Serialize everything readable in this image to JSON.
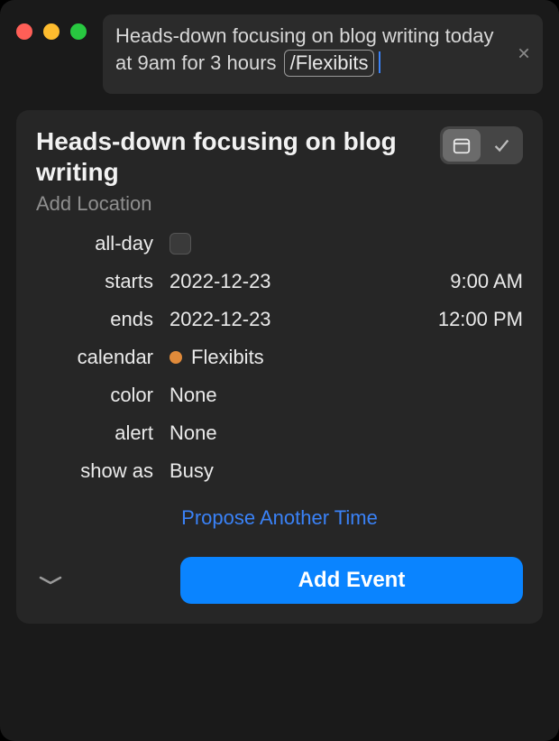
{
  "input": {
    "text_before_token": "Heads-down focusing on blog writing today at 9am for 3 hours ",
    "token": "/Flexibits"
  },
  "event": {
    "title": "Heads-down focusing on blog writing",
    "location_placeholder": "Add Location"
  },
  "fields": {
    "allday_label": "all-day",
    "starts_label": "starts",
    "starts_date": "2022-12-23",
    "starts_time": "9:00 AM",
    "ends_label": "ends",
    "ends_date": "2022-12-23",
    "ends_time": "12:00 PM",
    "calendar_label": "calendar",
    "calendar_value": "Flexibits",
    "calendar_color": "#e08a3a",
    "color_label": "color",
    "color_value": "None",
    "alert_label": "alert",
    "alert_value": "None",
    "showas_label": "show as",
    "showas_value": "Busy"
  },
  "actions": {
    "propose": "Propose Another Time",
    "add": "Add Event"
  },
  "colors": {
    "accent": "#0a84ff"
  }
}
